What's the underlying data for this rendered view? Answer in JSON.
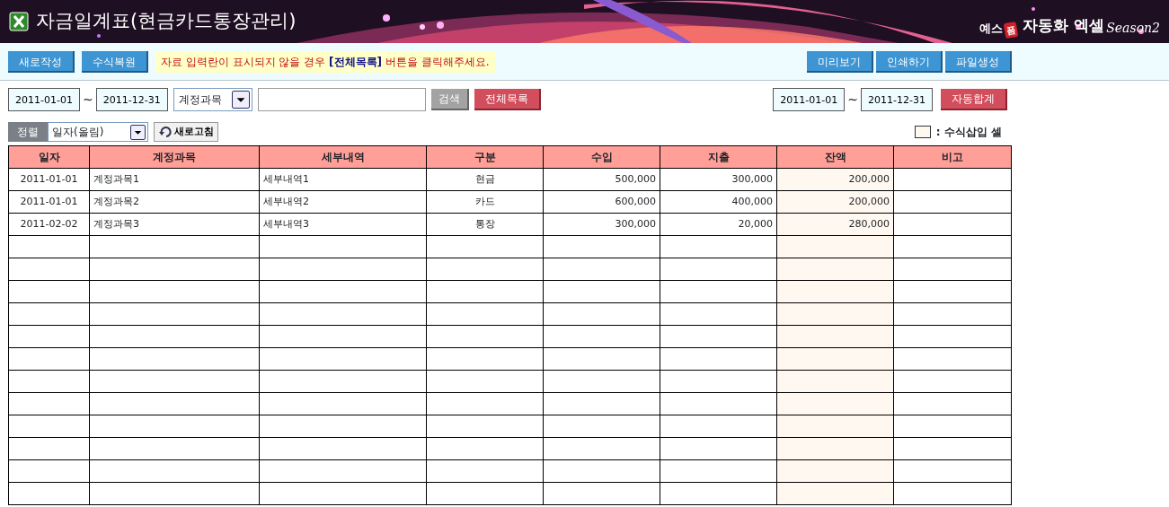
{
  "header": {
    "title": "자금일계표(현금카드통장관리)",
    "brand": {
      "prefix": "예스",
      "badge": "폼",
      "name": "자동화 엑셀",
      "season": "Season2"
    }
  },
  "toolbar": {
    "left_buttons": [
      "새로작성",
      "수식복원"
    ],
    "notice": "자료 입력란이 표시되지  않을 경우 **[전체목록]** 버튼을 클릭해주세요.",
    "right_buttons": [
      "미리보기",
      "인쇄하기",
      "파일생성"
    ]
  },
  "filter": {
    "date_from": "2011-01-01",
    "tilde": "~",
    "date_to": "2011-12-31",
    "field_select": "계정과목",
    "search_button": "검색",
    "all_button": "전체목록"
  },
  "summary": {
    "date_from": "2011-01-01",
    "tilde": "~",
    "date_to": "2011-12-31",
    "button": "자동합계"
  },
  "sort": {
    "label": "정렬",
    "value": "일자(올림)",
    "refresh_button": "새로고침"
  },
  "legend": {
    "text": ": 수식삽입 셀"
  },
  "table": {
    "columns": [
      {
        "label": "일자",
        "formula": false
      },
      {
        "label": "계정과목",
        "formula": false
      },
      {
        "label": "세부내역",
        "formula": false
      },
      {
        "label": "구분",
        "formula": false
      },
      {
        "label": "수입",
        "formula": false
      },
      {
        "label": "지출",
        "formula": false
      },
      {
        "label": "잔액",
        "formula": true
      },
      {
        "label": "비고",
        "formula": false
      }
    ],
    "rows": [
      {
        "kind": "data",
        "cells": [
          "2011-01-01",
          "계정과목1",
          "세부내역1",
          "현금",
          "500,000",
          "300,000",
          "200,000",
          null
        ]
      },
      {
        "kind": "data",
        "cells": [
          "2011-01-01",
          "계정과목2",
          "세부내역2",
          "카드",
          "600,000",
          "400,000",
          "200,000",
          null
        ]
      },
      {
        "kind": "data",
        "cells": [
          "2011-02-02",
          "계정과목3",
          "세부내역3",
          "통장",
          "300,000",
          "20,000",
          "280,000",
          null
        ]
      },
      {
        "kind": "blank"
      },
      {
        "kind": "blank"
      },
      {
        "kind": "blank"
      },
      {
        "kind": "blank"
      },
      {
        "kind": "blank"
      },
      {
        "kind": "blank"
      },
      {
        "kind": "blank"
      },
      {
        "kind": "blank"
      },
      {
        "kind": "blank"
      },
      {
        "kind": "blank"
      },
      {
        "kind": "blank"
      },
      {
        "kind": "blank"
      }
    ]
  }
}
